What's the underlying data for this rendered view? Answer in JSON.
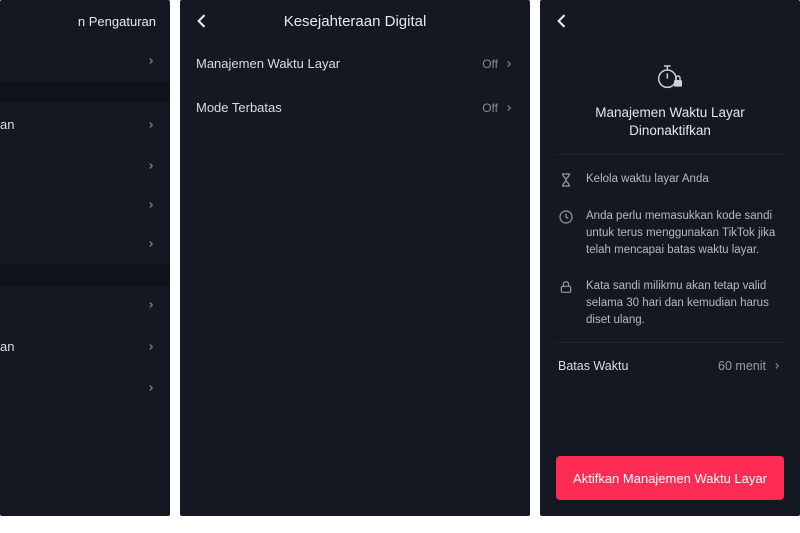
{
  "colors": {
    "accent": "#fe2c55",
    "bg": "#141822",
    "text": "#e6e6ea",
    "muted": "#8a8a92"
  },
  "panel1": {
    "header_title_fragment": "n Pengaturan",
    "rows": [
      {
        "label": ""
      },
      {
        "label": "an"
      },
      {
        "label": ""
      },
      {
        "label": ""
      },
      {
        "label": ""
      },
      {
        "label": ""
      },
      {
        "label": "an"
      },
      {
        "label": ""
      }
    ]
  },
  "panel2": {
    "title": "Kesejahteraan Digital",
    "items": [
      {
        "label": "Manajemen Waktu Layar",
        "value": "Off"
      },
      {
        "label": "Mode Terbatas",
        "value": "Off"
      }
    ]
  },
  "panel3": {
    "title": "Manajemen Waktu Layar Dinonaktifkan",
    "info": [
      {
        "icon": "hourglass",
        "text": "Kelola waktu layar Anda"
      },
      {
        "icon": "clock",
        "text": "Anda perlu memasukkan kode sandi untuk terus menggunakan TikTok jika telah mencapai batas waktu layar."
      },
      {
        "icon": "lock",
        "text": "Kata sandi milikmu akan tetap valid selama 30 hari dan kemudian harus diset ulang."
      }
    ],
    "limit": {
      "label": "Batas Waktu",
      "value": "60 menit"
    },
    "cta": "Aktifkan Manajemen Waktu Layar"
  }
}
